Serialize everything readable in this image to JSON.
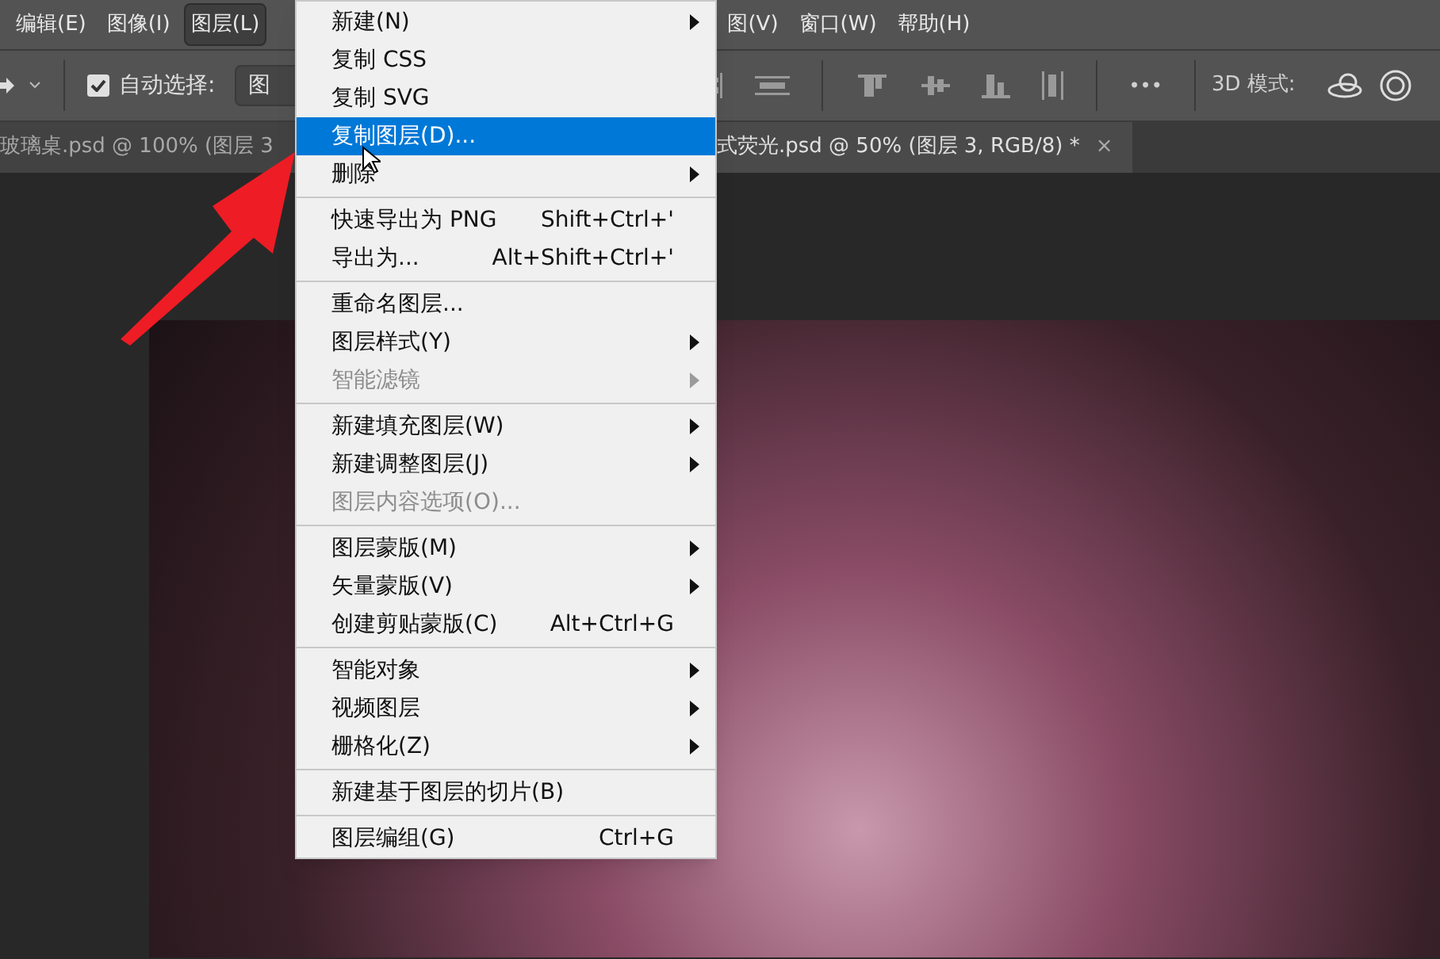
{
  "menubar": [
    {
      "label": "编辑(E)",
      "selected": false
    },
    {
      "label": "图像(I)",
      "selected": false
    },
    {
      "label": "图层(L)",
      "selected": true
    },
    {
      "label": "图(V)",
      "selected": false
    },
    {
      "label": "窗口(W)",
      "selected": false
    },
    {
      "label": "帮助(H)",
      "selected": false
    }
  ],
  "options_bar": {
    "auto_select": {
      "label": "自动选择:",
      "checked": true
    },
    "target_dropdown": {
      "value": "图"
    },
    "mode_3d_label": "3D 模式:",
    "more": "•••"
  },
  "tabs": [
    {
      "label": "玻璃桌.psd @ 100% (图层 3",
      "selected": false
    },
    {
      "label": "式荧光.psd @ 50% (图层 3, RGB/8) *",
      "close": "×",
      "selected": true
    }
  ],
  "menu": [
    {
      "kind": "item",
      "label": "新建(N)",
      "submenu": true,
      "disabled": false,
      "selected": false
    },
    {
      "kind": "item",
      "label": "复制 CSS",
      "submenu": false,
      "disabled": false,
      "selected": false
    },
    {
      "kind": "item",
      "label": "复制 SVG",
      "submenu": false,
      "disabled": false,
      "selected": false
    },
    {
      "kind": "item",
      "label": "复制图层(D)...",
      "submenu": false,
      "disabled": false,
      "selected": true
    },
    {
      "kind": "item",
      "label": "删除",
      "submenu": true,
      "disabled": false,
      "selected": false
    },
    {
      "kind": "separator"
    },
    {
      "kind": "item",
      "label": "快速导出为 PNG",
      "shortcut": "Shift+Ctrl+'",
      "submenu": false,
      "disabled": false,
      "selected": false
    },
    {
      "kind": "item",
      "label": "导出为...",
      "shortcut": "Alt+Shift+Ctrl+'",
      "submenu": false,
      "disabled": false,
      "selected": false
    },
    {
      "kind": "separator"
    },
    {
      "kind": "item",
      "label": "重命名图层...",
      "submenu": false,
      "disabled": false,
      "selected": false
    },
    {
      "kind": "item",
      "label": "图层样式(Y)",
      "submenu": true,
      "disabled": false,
      "selected": false
    },
    {
      "kind": "item",
      "label": "智能滤镜",
      "submenu": true,
      "disabled": true,
      "selected": false
    },
    {
      "kind": "separator"
    },
    {
      "kind": "item",
      "label": "新建填充图层(W)",
      "submenu": true,
      "disabled": false,
      "selected": false
    },
    {
      "kind": "item",
      "label": "新建调整图层(J)",
      "submenu": true,
      "disabled": false,
      "selected": false
    },
    {
      "kind": "item",
      "label": "图层内容选项(O)...",
      "submenu": false,
      "disabled": true,
      "selected": false
    },
    {
      "kind": "separator"
    },
    {
      "kind": "item",
      "label": "图层蒙版(M)",
      "submenu": true,
      "disabled": false,
      "selected": false
    },
    {
      "kind": "item",
      "label": "矢量蒙版(V)",
      "submenu": true,
      "disabled": false,
      "selected": false
    },
    {
      "kind": "item",
      "label": "创建剪贴蒙版(C)",
      "shortcut": "Alt+Ctrl+G",
      "submenu": false,
      "disabled": false,
      "selected": false
    },
    {
      "kind": "separator"
    },
    {
      "kind": "item",
      "label": "智能对象",
      "submenu": true,
      "disabled": false,
      "selected": false
    },
    {
      "kind": "item",
      "label": "视频图层",
      "submenu": true,
      "disabled": false,
      "selected": false
    },
    {
      "kind": "item",
      "label": "栅格化(Z)",
      "submenu": true,
      "disabled": false,
      "selected": false
    },
    {
      "kind": "separator"
    },
    {
      "kind": "item",
      "label": "新建基于图层的切片(B)",
      "submenu": false,
      "disabled": false,
      "selected": false
    },
    {
      "kind": "separator"
    },
    {
      "kind": "item",
      "label": "图层编组(G)",
      "shortcut": "Ctrl+G",
      "submenu": false,
      "disabled": false,
      "selected": false
    }
  ]
}
